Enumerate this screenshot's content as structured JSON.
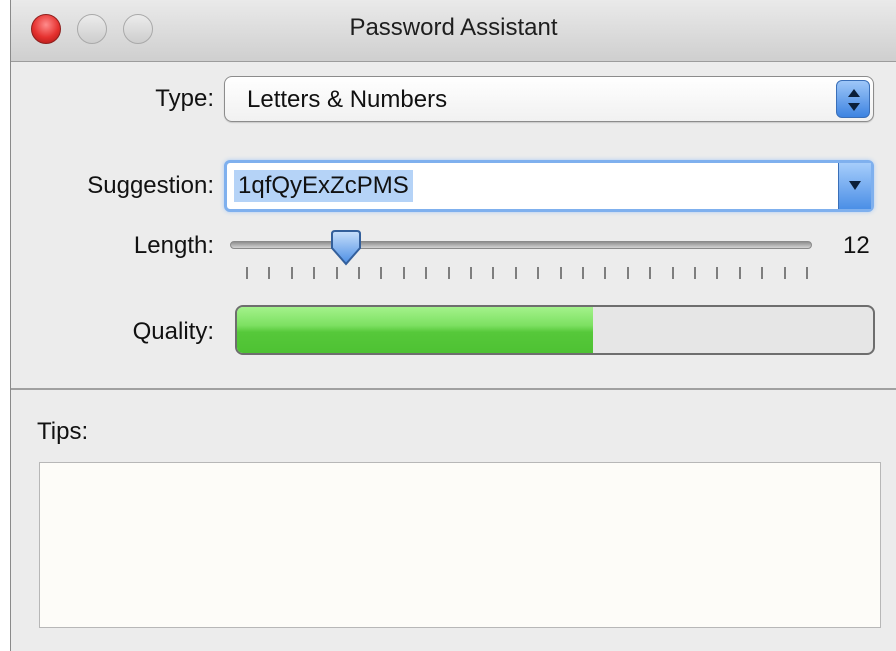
{
  "window": {
    "title": "Password Assistant"
  },
  "type": {
    "label": "Type:",
    "value": "Letters & Numbers"
  },
  "suggestion": {
    "label": "Suggestion:",
    "value": "1qfQyExZcPMS"
  },
  "length": {
    "label": "Length:",
    "value": "12",
    "slider_fraction": 0.18,
    "tick_count": 26
  },
  "quality": {
    "label": "Quality:",
    "fill_fraction": 0.56,
    "color": "#5ccf3f"
  },
  "tips": {
    "label": "Tips:",
    "text": ""
  },
  "icons": {
    "close": "close-icon",
    "minimize": "minimize-icon",
    "zoom": "zoom-icon",
    "popup_arrows": "up-down-arrows-icon",
    "combo_arrow": "chevron-down-icon"
  }
}
